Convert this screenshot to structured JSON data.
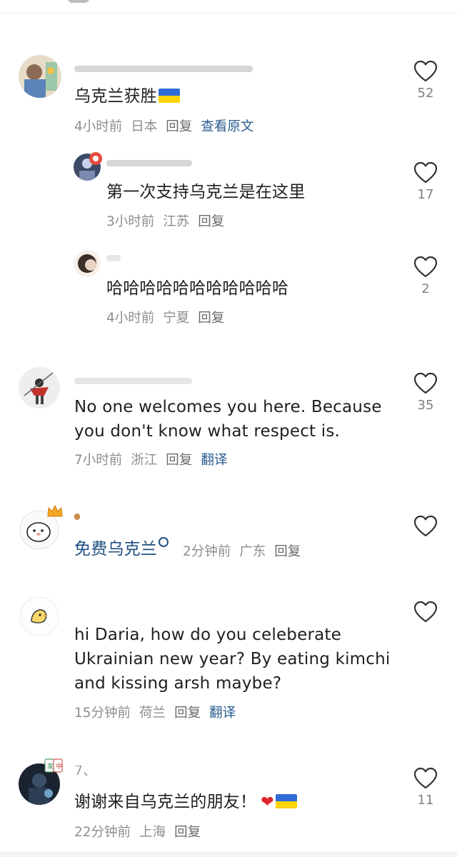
{
  "comments": [
    {
      "text": "乌克兰获胜",
      "time": "4小时前",
      "location": "日本",
      "reply": "回复",
      "action": "查看原文",
      "likes": "52"
    },
    {
      "text": "第一次支持乌克兰是在这里",
      "time": "3小时前",
      "location": "江苏",
      "reply": "回复",
      "likes": "17"
    },
    {
      "text": "哈哈哈哈哈哈哈哈哈哈哈",
      "time": "4小时前",
      "location": "宁夏",
      "reply": "回复",
      "likes": "2"
    },
    {
      "text": "No one welcomes you here. Because you don't know what respect is.",
      "time": "7小时前",
      "location": "浙江",
      "reply": "回复",
      "action": "翻译",
      "likes": "35"
    },
    {
      "text": "免费乌克兰",
      "time": "2分钟前",
      "location": "广东",
      "reply": "回复",
      "likes": ""
    },
    {
      "text": "hi Daria, how do you celeberate Ukrainian new year? By eating kimchi and kissing arsh maybe?",
      "time": "15分钟前",
      "location": "荷兰",
      "reply": "回复",
      "action": "翻译",
      "likes": ""
    },
    {
      "username": "7、",
      "text": "谢谢来自乌克兰的朋友！",
      "time": "22分钟前",
      "location": "上海",
      "reply": "回复",
      "likes": "11"
    }
  ],
  "icon_names": [
    "heart-outline-icon",
    "ukraine-flag-icon",
    "red-heart-icon",
    "search-icon"
  ],
  "colors": {
    "text": "#1f1f1f",
    "meta": "#8e8e8e",
    "link": "#1f4f82",
    "flag_blue": "#2f6bd9",
    "flag_yellow": "#ffd400",
    "heart_red": "#e0252c"
  }
}
